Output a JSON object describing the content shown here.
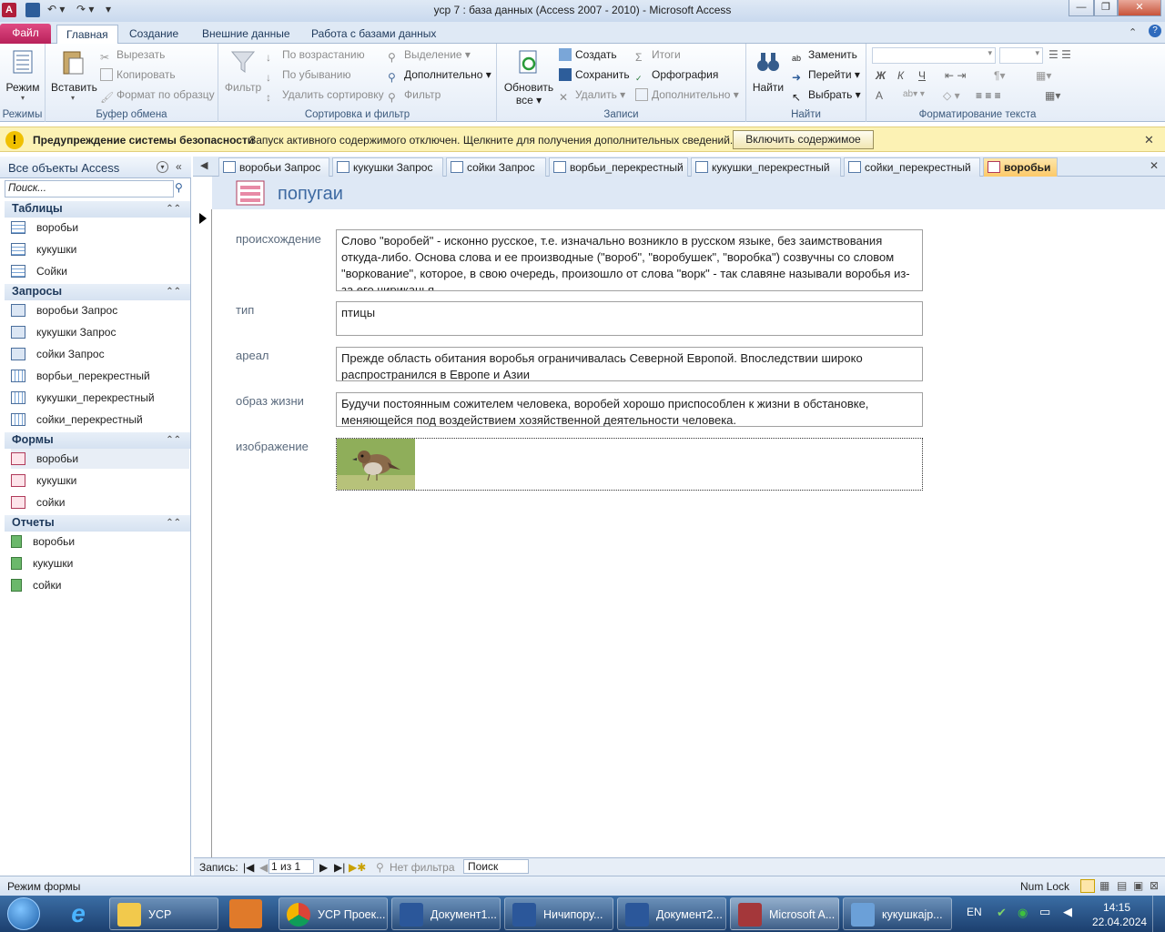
{
  "window": {
    "title": "уср 7 : база данных (Access 2007 - 2010)  -  Microsoft Access"
  },
  "ribbon_tabs": [
    "Файл",
    "Главная",
    "Создание",
    "Внешние данные",
    "Работа с базами данных"
  ],
  "ribbon": {
    "modes": {
      "view_label": "Режим",
      "group": "Режимы"
    },
    "clipboard": {
      "paste": "Вставить",
      "cut": "Вырезать",
      "copy": "Копировать",
      "format_painter": "Формат по образцу",
      "group": "Буфер обмена"
    },
    "sort_filter": {
      "filter": "Фильтр",
      "ascending": "По возрастанию",
      "descending": "По убыванию",
      "remove_sort": "Удалить сортировку",
      "selection": "Выделение",
      "advanced": "Дополнительно",
      "toggle_filter": "Фильтр",
      "group": "Сортировка и фильтр"
    },
    "records": {
      "refresh": "Обновить",
      "refresh2": "все",
      "new": "Создать",
      "save": "Сохранить",
      "delete": "Удалить",
      "totals": "Итоги",
      "spelling": "Орфография",
      "more": "Дополнительно",
      "group": "Записи"
    },
    "find": {
      "find": "Найти",
      "replace": "Заменить",
      "goto": "Перейти",
      "select": "Выбрать",
      "group": "Найти"
    },
    "text_format": {
      "bold": "Ж",
      "italic": "К",
      "underline": "Ч",
      "font_color": "A",
      "group": "Форматирование текста"
    }
  },
  "security_bar": {
    "title": "Предупреждение системы безопасности",
    "message": "Запуск активного содержимого отключен. Щелкните для получения дополнительных сведений.",
    "button": "Включить содержимое"
  },
  "nav_pane": {
    "title": "Все объекты Access",
    "search_placeholder": "Поиск...",
    "sections": [
      {
        "name": "Таблицы",
        "items": [
          "воробьи",
          "кукушки",
          "Сойки"
        ]
      },
      {
        "name": "Запросы",
        "items": [
          "воробьи Запрос",
          "кукушки Запрос",
          "сойки Запрос",
          "ворбьи_перекрестный",
          "кукушки_перекрестный",
          "сойки_перекрестный"
        ]
      },
      {
        "name": "Формы",
        "items": [
          "воробьи",
          "кукушки",
          "сойки"
        ]
      },
      {
        "name": "Отчеты",
        "items": [
          "воробьи",
          "кукушки",
          "сойки"
        ]
      }
    ]
  },
  "doc_tabs": [
    "воробьи Запрос",
    "кукушки Запрос",
    "сойки Запрос",
    "ворбьи_перекрестный",
    "кукушки_перекрестный",
    "сойки_перекрестный",
    "воробьи"
  ],
  "form": {
    "title": "попугаи",
    "fields": [
      {
        "label": "происхождение",
        "value": "Слово \"воробей\" - исконно русское, т.е. изначально возникло в русском языке, без заимствования откуда-либо. Основа слова и ее производные (\"вороб\", \"воробушек\", \"воробка\") созвучны со словом \"воркование\", которое, в свою очередь, произошло от слова \"ворк\" - так славяне называли воробья из-за его чириканья."
      },
      {
        "label": "тип",
        "value": "птицы"
      },
      {
        "label": "ареал",
        "value": "Прежде область обитания воробья ограничивалась Северной Европой. Впоследствии широко распространился в Европе и Азии"
      },
      {
        "label": "образ жизни",
        "value": "Будучи постоянным сожителем человека, воробей хорошо приспособлен к жизни в обстановке, меняющейся под воздействием хозяйственной деятельности человека."
      },
      {
        "label": "изображение",
        "value": ""
      }
    ]
  },
  "record_nav": {
    "label": "Запись:",
    "position": "1 из 1",
    "filter": "Нет фильтра",
    "search": "Поиск"
  },
  "status": {
    "mode": "Режим формы",
    "numlock": "Num Lock"
  },
  "taskbar": {
    "items": [
      "УСР",
      "УСР Проек...",
      "Документ1...",
      "Ничипору...",
      "Документ2...",
      "Microsoft A...",
      "кукушкајр..."
    ],
    "lang": "EN",
    "time": "14:15",
    "date": "22.04.2024"
  }
}
